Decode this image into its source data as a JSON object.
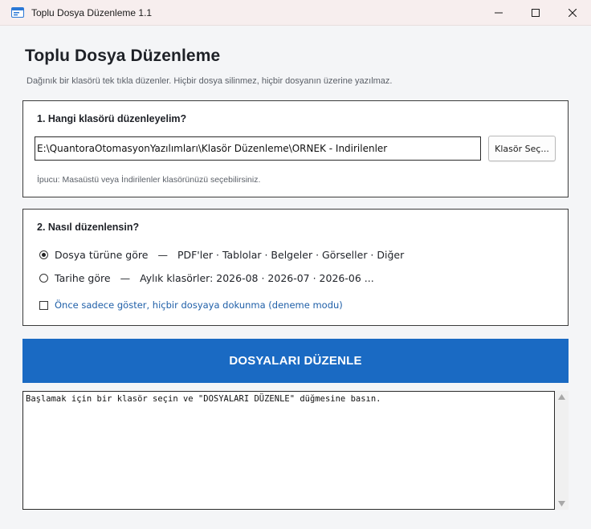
{
  "window": {
    "title": "Toplu Dosya Düzenleme 1.1"
  },
  "header": {
    "title": "Toplu Dosya Düzenleme",
    "subtitle": "Dağınık bir klasörü tek tıkla düzenler. Hiçbir dosya silinmez, hiçbir dosyanın üzerine yazılmaz."
  },
  "folder_section": {
    "heading": "1. Hangi klasörü düzenleyelim?",
    "path_value": "E:\\QuantoraOtomasyonYazılımları\\Klasör Düzenleme\\ORNEK - Indirilenler",
    "browse_label": "Klasör Seç...",
    "hint": "İpucu: Masaüstü veya İndirilenler klasörünüzü seçebilirsiniz."
  },
  "mode_section": {
    "heading": "2. Nasıl düzenlensin?",
    "options": [
      {
        "label": "Dosya türüne göre",
        "separator": "—",
        "description": "PDF'ler · Tablolar · Belgeler · Görseller · Diğer",
        "selected": true
      },
      {
        "label": "Tarihe göre",
        "separator": "—",
        "description": "Aylık klasörler: 2026-08 · 2026-07 · 2026-06 ...",
        "selected": false
      }
    ],
    "dry_run_label": "Önce sadece göster, hiçbir dosyaya dokunma (deneme modu)",
    "dry_run_checked": false
  },
  "run_button_label": "DOSYALARI DÜZENLE",
  "log": {
    "text": "Başlamak için bir klasör seçin ve \"DOSYALARI DÜZENLE\" düğmesine basın."
  },
  "colors": {
    "accent": "#1a6ac3",
    "link_text": "#1f5fa8",
    "background": "#f4f5f7",
    "titlebar": "#f7eeee"
  },
  "icons": {
    "app": "app-window-icon",
    "minimize": "minimize-icon",
    "maximize": "maximize-icon",
    "close": "close-icon"
  }
}
